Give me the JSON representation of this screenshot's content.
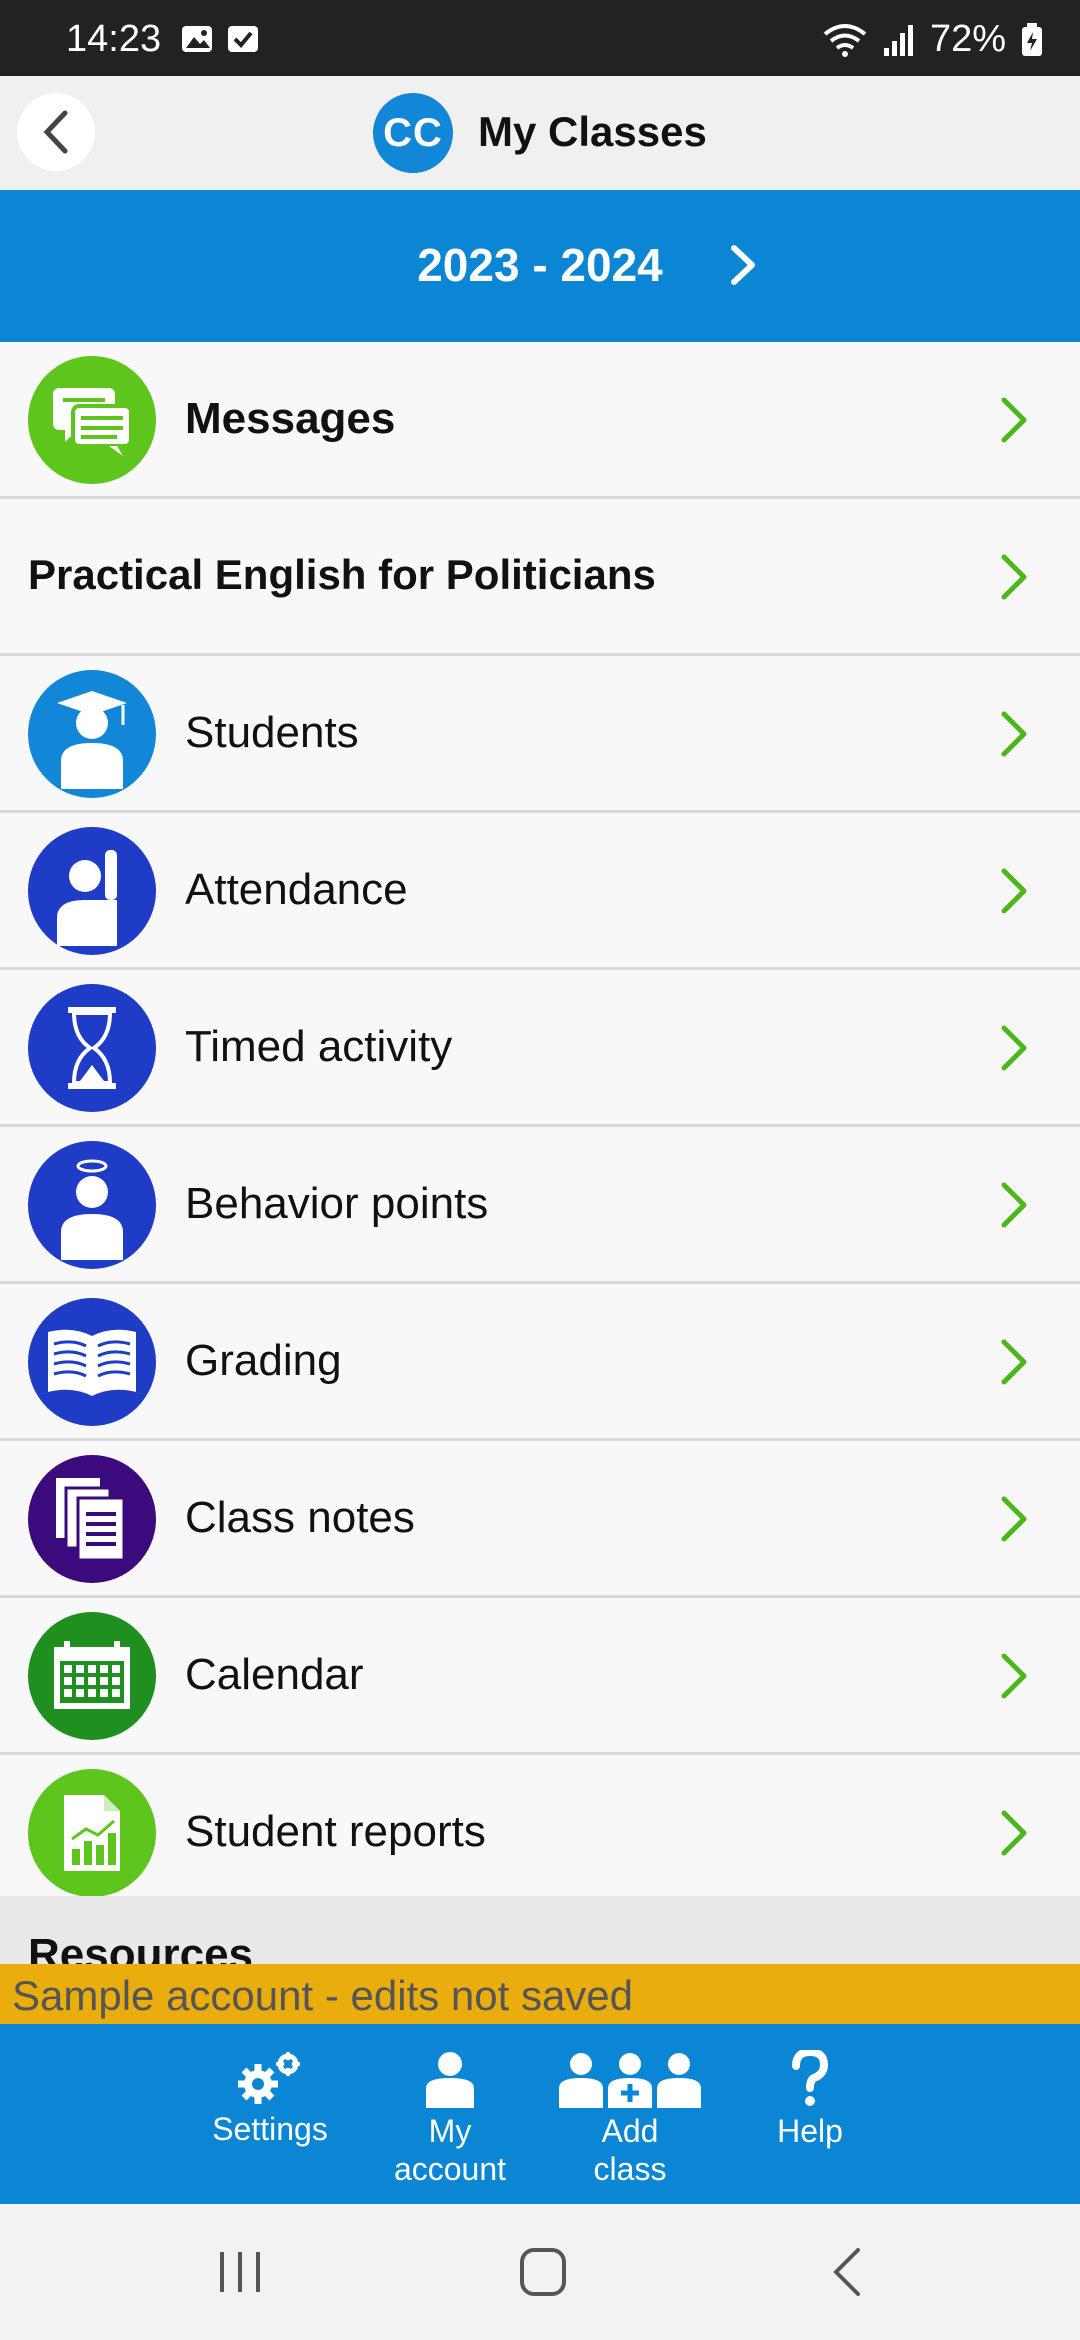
{
  "status_bar": {
    "time": "14:23",
    "battery": "72%"
  },
  "header": {
    "logo_text": "CC",
    "title": "My Classes"
  },
  "year_selector": {
    "label": "2023 - 2024"
  },
  "messages": {
    "label": "Messages"
  },
  "class_name": "Practical English for Politicians",
  "menu": [
    {
      "label": "Students",
      "icon": "graduate-icon",
      "color": "#1287d8"
    },
    {
      "label": "Attendance",
      "icon": "raised-hand-icon",
      "color": "#1e3cc6"
    },
    {
      "label": "Timed activity",
      "icon": "hourglass-icon",
      "color": "#1e3cc6"
    },
    {
      "label": "Behavior points",
      "icon": "halo-person-icon",
      "color": "#1e3cc6"
    },
    {
      "label": "Grading",
      "icon": "open-book-icon",
      "color": "#1e3cc6"
    },
    {
      "label": "Class notes",
      "icon": "documents-icon",
      "color": "#3b0a7c"
    },
    {
      "label": "Calendar",
      "icon": "calendar-icon",
      "color": "#1f8f1f"
    },
    {
      "label": "Student reports",
      "icon": "report-chart-icon",
      "color": "#5ec51d"
    }
  ],
  "resources_label": "Resources",
  "banner": "Sample account - edits not saved",
  "tabs": [
    {
      "label": "Settings"
    },
    {
      "label": "My account"
    },
    {
      "label": "Add class"
    },
    {
      "label": "Help"
    }
  ],
  "colors": {
    "accent_blue": "#0b86d5",
    "chevron_green": "#4cb61c",
    "banner_yellow": "#e9ae0e"
  }
}
